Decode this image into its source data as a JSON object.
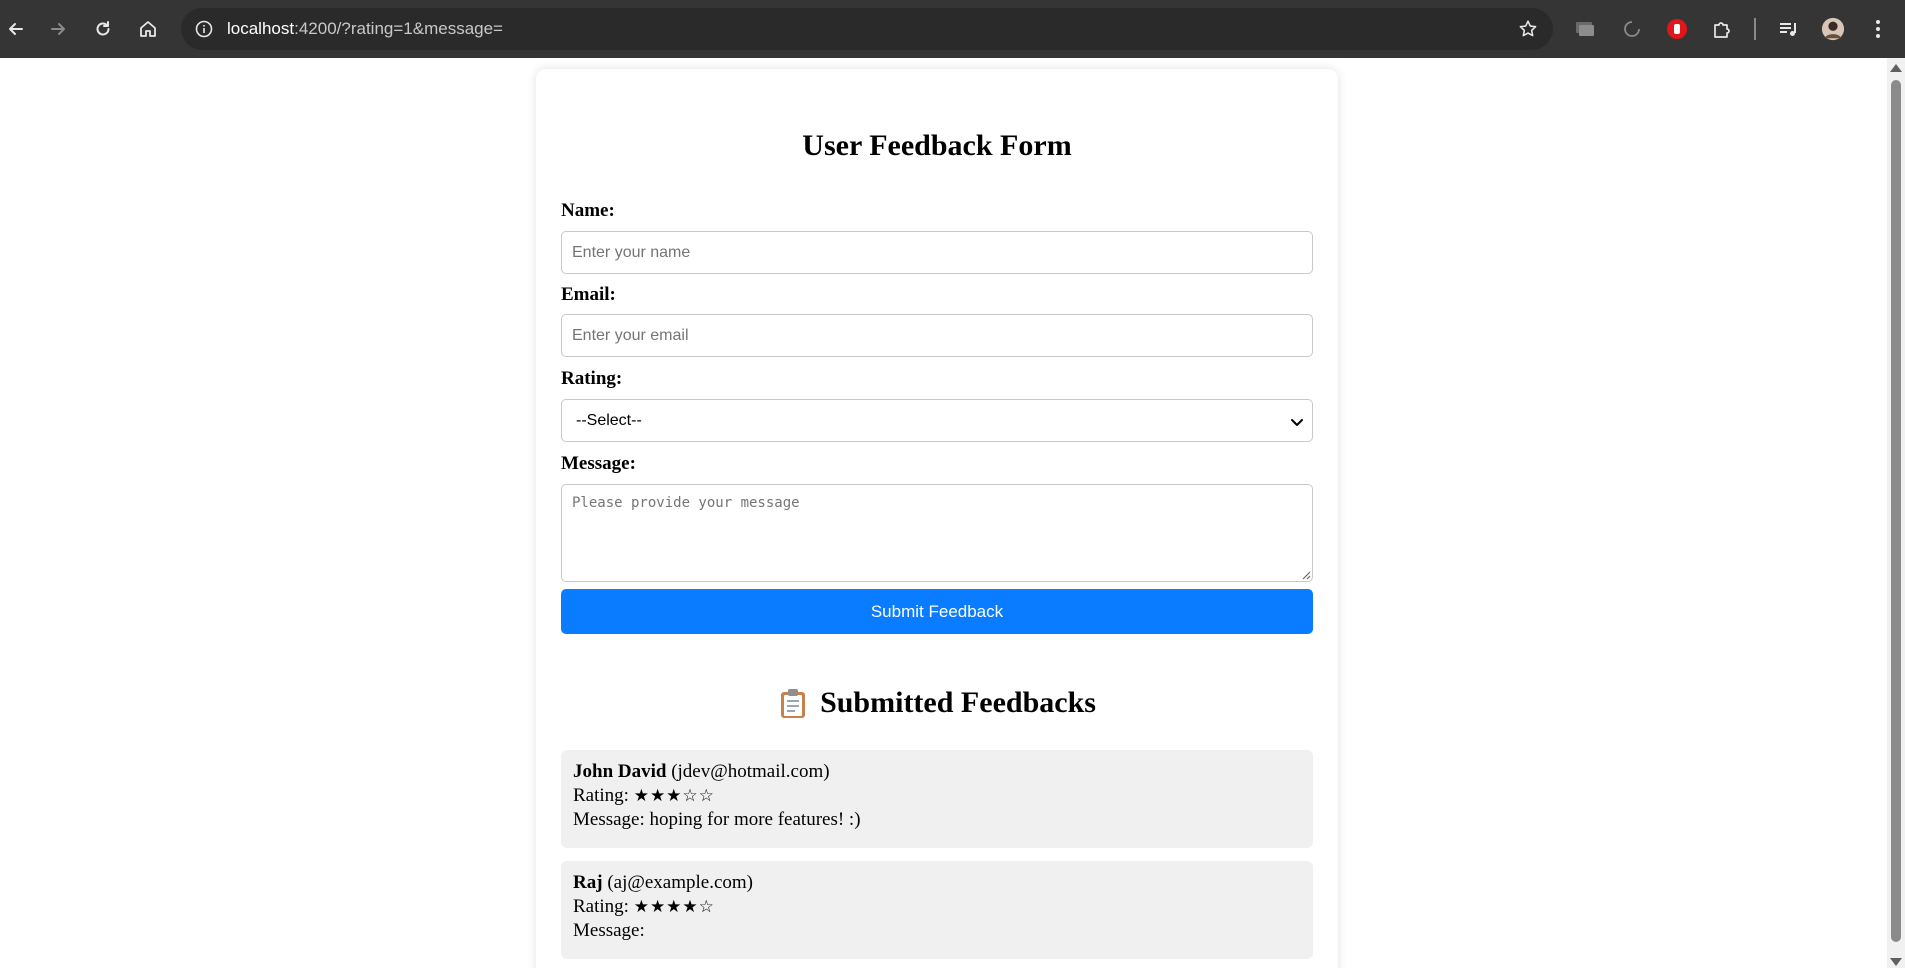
{
  "browser": {
    "url_host": "localhost",
    "url_rest": ":4200/?rating=1&message="
  },
  "form": {
    "title": "User Feedback Form",
    "name_label": "Name:",
    "name_placeholder": "Enter your name",
    "email_label": "Email:",
    "email_placeholder": "Enter your email",
    "rating_label": "Rating:",
    "rating_selected": "--Select--",
    "message_label": "Message:",
    "message_placeholder": "Please provide your message",
    "submit_label": "Submit Feedback"
  },
  "feedbacks": {
    "title": "Submitted Feedbacks",
    "icon": "clipboard-icon",
    "items": [
      {
        "name": "John David",
        "email": "(jdev@hotmail.com)",
        "rating_prefix": "Rating:",
        "stars": "★★★☆☆",
        "rating": 3,
        "message": "Message: hoping for more features! :)"
      },
      {
        "name": "Raj",
        "email": "(aj@example.com)",
        "rating_prefix": "Rating:",
        "stars": "★★★★☆",
        "rating": 4,
        "message": "Message:"
      }
    ]
  },
  "colors": {
    "chrome_bg": "#353535",
    "submit_bg": "#0a7cff",
    "item_bg": "#f0f0f0"
  }
}
